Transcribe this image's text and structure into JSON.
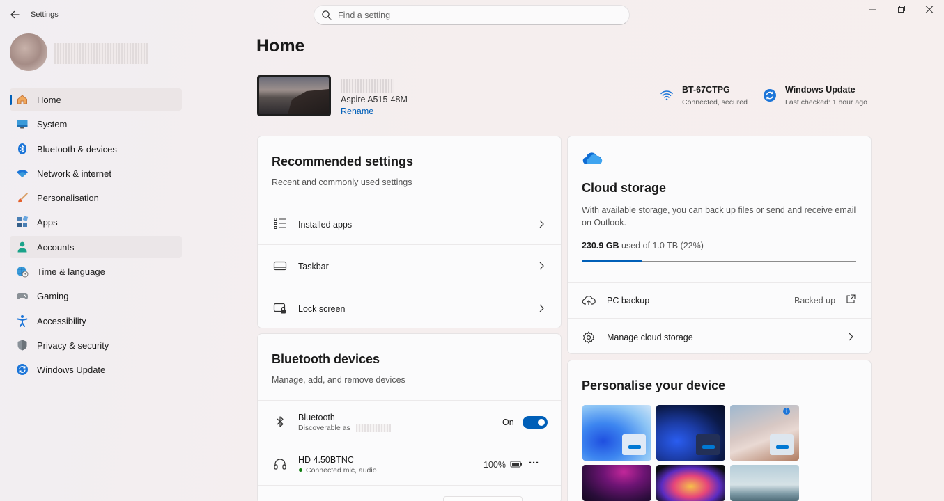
{
  "window": {
    "title": "Settings",
    "search_placeholder": "Find a setting"
  },
  "sidebar": {
    "items": [
      {
        "label": "Home",
        "icon": "home-icon",
        "selected": true
      },
      {
        "label": "System",
        "icon": "monitor-icon"
      },
      {
        "label": "Bluetooth & devices",
        "icon": "bluetooth-icon"
      },
      {
        "label": "Network & internet",
        "icon": "wifi-icon"
      },
      {
        "label": "Personalisation",
        "icon": "brush-icon"
      },
      {
        "label": "Apps",
        "icon": "apps-icon"
      },
      {
        "label": "Accounts",
        "icon": "person-icon",
        "hovered": true
      },
      {
        "label": "Time & language",
        "icon": "globe-clock-icon"
      },
      {
        "label": "Gaming",
        "icon": "gamepad-icon"
      },
      {
        "label": "Accessibility",
        "icon": "accessibility-icon"
      },
      {
        "label": "Privacy & security",
        "icon": "shield-icon"
      },
      {
        "label": "Windows Update",
        "icon": "update-icon"
      }
    ]
  },
  "page": {
    "title": "Home"
  },
  "device": {
    "model": "Aspire A515-48M",
    "rename_label": "Rename"
  },
  "network_status": {
    "name": "BT-67CTPG",
    "sub": "Connected, secured"
  },
  "update_status": {
    "name": "Windows Update",
    "sub": "Last checked: 1 hour ago"
  },
  "recommended": {
    "title": "Recommended settings",
    "subtitle": "Recent and commonly used settings",
    "rows": [
      {
        "label": "Installed apps",
        "icon": "list-icon"
      },
      {
        "label": "Taskbar",
        "icon": "taskbar-icon"
      },
      {
        "label": "Lock screen",
        "icon": "lock-screen-icon"
      }
    ]
  },
  "bluetooth": {
    "title": "Bluetooth devices",
    "subtitle": "Manage, add, and remove devices",
    "bt_label": "Bluetooth",
    "bt_sub": "Discoverable as",
    "toggle_label": "On",
    "toggle_on": true,
    "device_name": "HD 4.50BTNC",
    "device_status": "Connected mic, audio",
    "battery": "100%",
    "more": "···"
  },
  "cloud": {
    "title": "Cloud storage",
    "description": "With available storage, you can back up files or send and receive email on Outlook.",
    "used": "230.9 GB",
    "used_rest": "used of 1.0 TB (22%)",
    "used_fraction": 0.22,
    "backup_label": "PC backup",
    "backup_status": "Backed up",
    "manage_label": "Manage cloud storage"
  },
  "personalise": {
    "title": "Personalise your device"
  },
  "colors": {
    "accent": "#005fb8",
    "online_dot": "#107c10"
  }
}
